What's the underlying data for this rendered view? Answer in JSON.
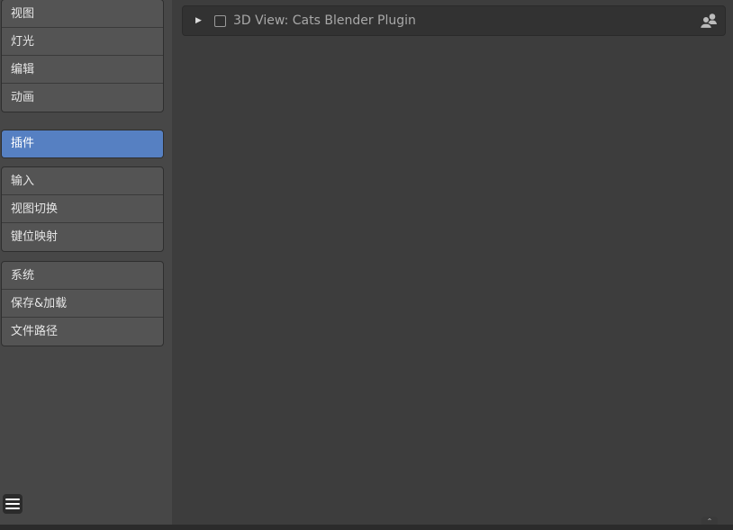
{
  "sidebar": {
    "groups": [
      {
        "items": [
          {
            "label": "视图"
          },
          {
            "label": "灯光"
          },
          {
            "label": "编辑"
          },
          {
            "label": "动画"
          }
        ]
      },
      {
        "items": [
          {
            "label": "插件",
            "active": true
          }
        ]
      },
      {
        "items": [
          {
            "label": "输入"
          },
          {
            "label": "视图切换"
          },
          {
            "label": "键位映射"
          }
        ]
      },
      {
        "items": [
          {
            "label": "系统"
          },
          {
            "label": "保存&加载"
          },
          {
            "label": "文件路径"
          }
        ]
      }
    ],
    "menu_icon": "hamburger-menu-icon"
  },
  "addon": {
    "title": "3D View: Cats Blender Plugin",
    "enabled": false,
    "expand_icon": "triangle-right-icon",
    "type_icon": "users-icon"
  },
  "colors": {
    "active_item": "#5680c2",
    "sidebar_bg": "#474747",
    "main_bg": "#3d3d3d",
    "panel_bg": "#323232"
  }
}
